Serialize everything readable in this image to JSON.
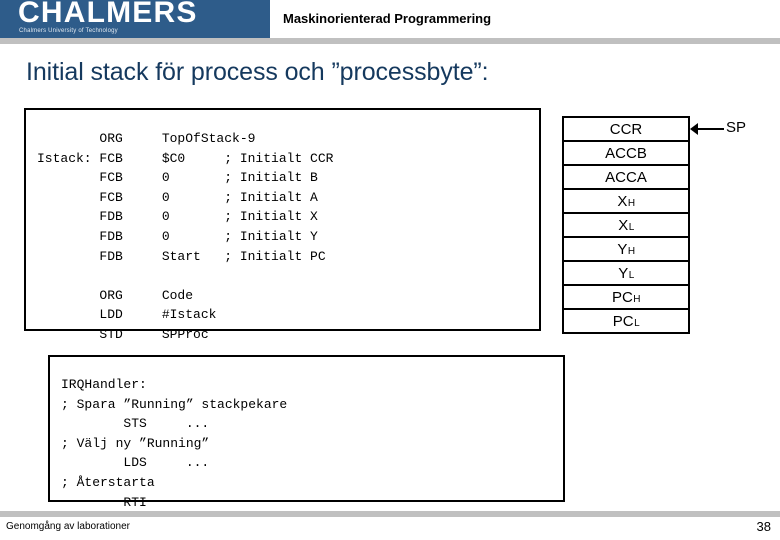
{
  "header": {
    "logo_wordmark": "CHALMERS",
    "logo_tagline": "Chalmers University of Technology",
    "subject": "Maskinorienterad Programmering",
    "brand_blue": "#2e5c8a",
    "rule_gray": "#c0c0c0"
  },
  "title": {
    "text": "Initial stack för process och ”processbyte”:",
    "color": "#15395e"
  },
  "code_init": {
    "text": "        ORG     TopOfStack-9\nIstack: FCB     $C0     ; Initialt CCR\n        FCB     0       ; Initialt B\n        FCB     0       ; Initialt A\n        FDB     0       ; Initialt X\n        FDB     0       ; Initialt Y\n        FDB     Start   ; Initialt PC\n\n        ORG     Code\n        LDD     #Istack\n        STD     SPProc"
  },
  "code_irq": {
    "text": "IRQHandler:\n; Spara ”Running” stackpekare\n        STS     ...\n; Välj ny ”Running”\n        LDS     ...\n; Återstarta\n        RTI"
  },
  "stack": {
    "rows": [
      {
        "label": "CCR",
        "sub": ""
      },
      {
        "label": "ACCB",
        "sub": ""
      },
      {
        "label": "ACCA",
        "sub": ""
      },
      {
        "label": "X",
        "sub": "H"
      },
      {
        "label": "X",
        "sub": "L"
      },
      {
        "label": "Y",
        "sub": "H"
      },
      {
        "label": "Y",
        "sub": "L"
      },
      {
        "label": "PC",
        "sub": "H"
      },
      {
        "label": "PC",
        "sub": "L"
      }
    ],
    "pointer_label": "SP"
  },
  "footer": {
    "text": "Genomgång av laborationer",
    "page": "38"
  }
}
